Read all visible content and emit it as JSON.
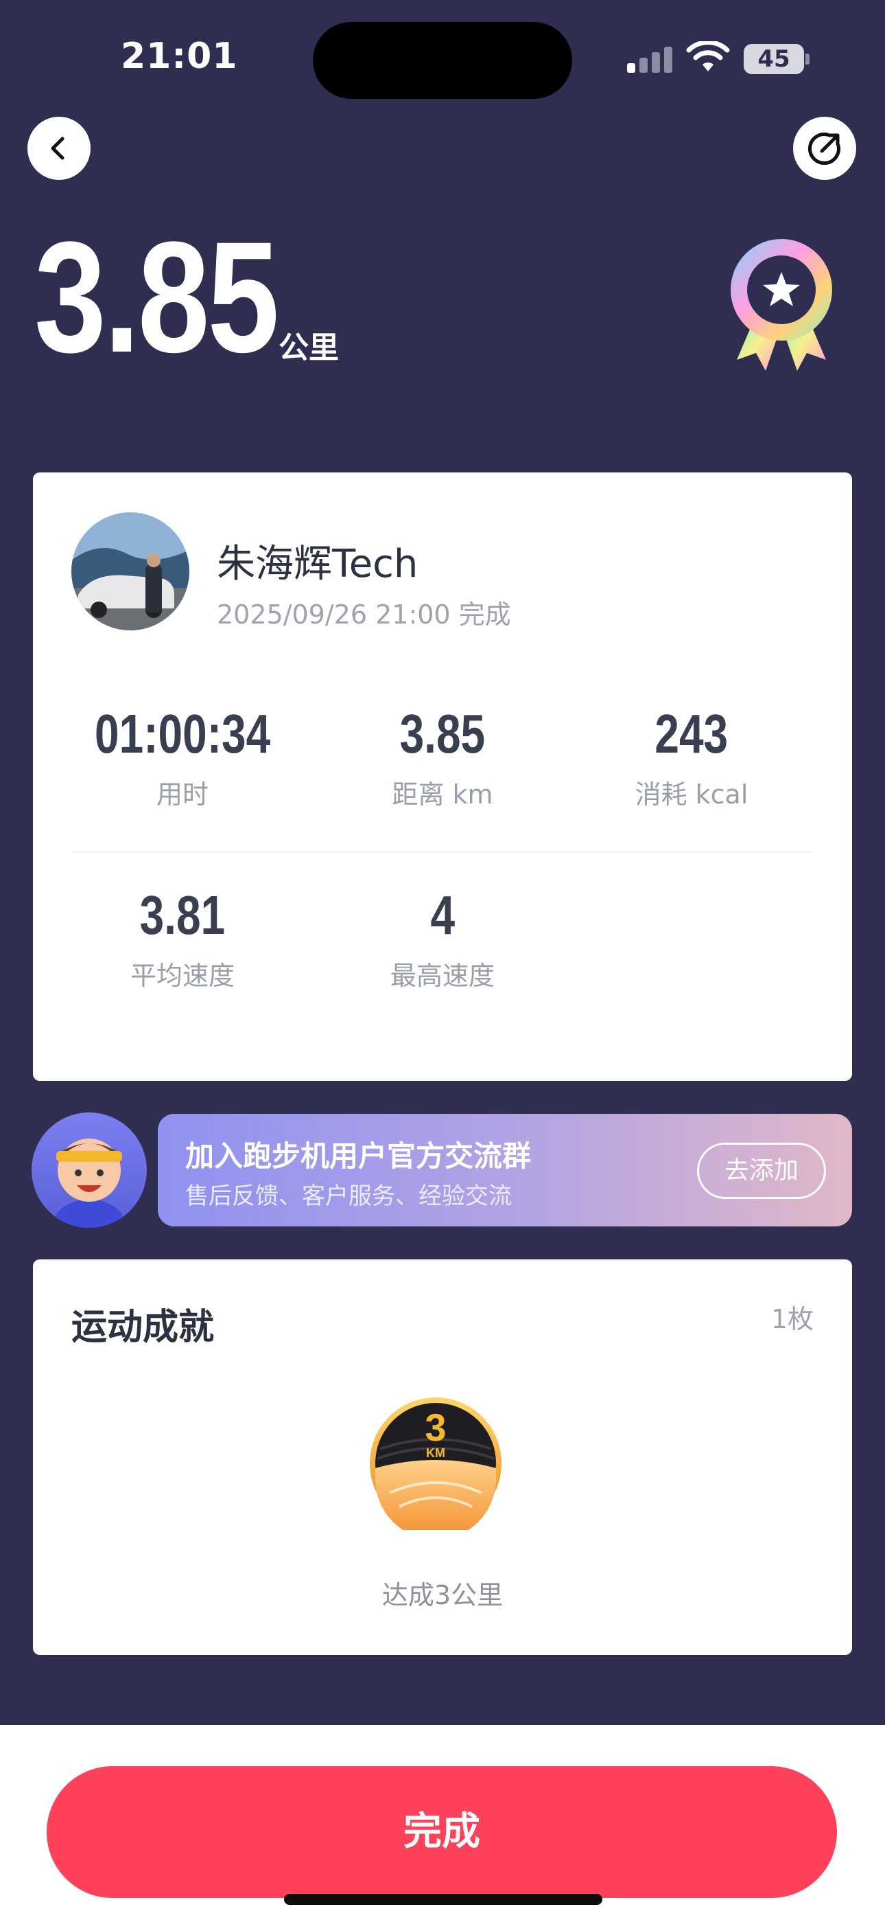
{
  "status": {
    "time": "21:01",
    "battery": "45"
  },
  "header": {
    "back_icon": "chevron-left-icon",
    "share_icon": "share-icon"
  },
  "run": {
    "distance": "3.85",
    "unit": "公里"
  },
  "user": {
    "name": "朱海辉Tech",
    "subtitle": "2025/09/26 21:00 完成"
  },
  "stats": [
    {
      "value": "01:00:34",
      "label": "用时"
    },
    {
      "value": "3.85",
      "label": "距离 km"
    },
    {
      "value": "243",
      "label": "消耗 kcal"
    },
    {
      "value": "3.81",
      "label": "平均速度"
    },
    {
      "value": "4",
      "label": "最高速度"
    }
  ],
  "banner": {
    "title": "加入跑步机用户官方交流群",
    "subtitle": "售后反馈、客户服务、经验交流",
    "button": "去添加"
  },
  "achievements": {
    "title": "运动成就",
    "count": "1枚",
    "badge_number": "3",
    "badge_unit": "KM",
    "badge_label": "达成3公里"
  },
  "footer": {
    "done": "完成"
  },
  "colors": {
    "background": "#2f2e50",
    "primary": "#ff4159",
    "card": "#ffffff"
  }
}
